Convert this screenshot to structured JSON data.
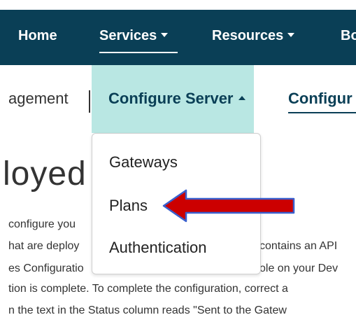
{
  "main_nav": {
    "items": [
      {
        "label": "Home"
      },
      {
        "label": "Services"
      },
      {
        "label": "Resources"
      },
      {
        "label": "Bo"
      }
    ]
  },
  "sub_nav": {
    "items": [
      {
        "label": "agement"
      },
      {
        "label": "Configure Server"
      },
      {
        "label": "Configur"
      }
    ]
  },
  "dropdown": {
    "items": [
      {
        "label": "Gateways"
      },
      {
        "label": "Plans"
      },
      {
        "label": "Authentication"
      }
    ]
  },
  "content": {
    "heading": "loyed",
    "lines": [
      "configure you",
      "hat are deploy",
      "es Configuratio",
      "tion is complete. To complete the configuration, correct a",
      "n the text in the Status column reads \"Sent to the Gatew"
    ],
    "right_fragments": [
      "contains an API",
      "ole on your Dev"
    ]
  },
  "annotation": {
    "arrow_color": "#cc0000",
    "arrow_outline_color": "#3a5fcd",
    "points_to": "Plans"
  },
  "colors": {
    "nav_bg": "#0a3f56",
    "active_tab_bg": "#b9e7e3",
    "nav_text": "#ffffff",
    "sub_text_active": "#0a3f56"
  }
}
